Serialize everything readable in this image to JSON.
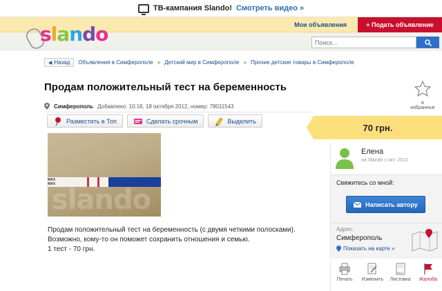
{
  "promo": {
    "text": "ТВ-кампания Slando!",
    "link": "Смотреть видео »"
  },
  "header": {
    "logo": "slando",
    "my_ads": "Мои объявления",
    "post_ad": "+ Подать объявление",
    "search": {
      "placeholder": "Поиск..."
    }
  },
  "breadcrumb": {
    "back": "Назад",
    "items": [
      "Объявления в Симферополе",
      "Детский мир в Симферополе",
      "Прочие детские товары в Симферополе"
    ],
    "separator": "»"
  },
  "ad": {
    "title": "Продам положительный тест на беременность",
    "favorite_label": "в избранные",
    "city": "Симферополь",
    "added": "Добавлено: 10:18, 18 октября 2012, номер: 78011543",
    "actions": [
      "Разместить в Топ",
      "Сделать срочным",
      "Выделить"
    ],
    "photo_watermark": "slando",
    "photo_test_label": "MAX",
    "description": [
      "Продам положительный тест на беременность (с двумя четкими полосками).",
      "Возможно, кому-то он поможет сохранить отношения и семью.",
      "1 тест - 70 грн."
    ]
  },
  "sidebar": {
    "price": "70 грн.",
    "seller_name": "Елена",
    "seller_since": "на Slando с окт. 2012",
    "contact_label": "Свяжитесь со мной:",
    "write_button": "Написать автору",
    "address_label": "Адрес:",
    "address_city": "Симферополь",
    "map_link": "Показать на карте »",
    "tools": [
      "Печать",
      "Изменить",
      "Листовка",
      "Жалоба"
    ]
  },
  "colors": {
    "accent_blue": "#2e6fc7",
    "post_red": "#c8102e",
    "price_yellow": "#fcdf7d",
    "link": "#1a4e8a"
  }
}
